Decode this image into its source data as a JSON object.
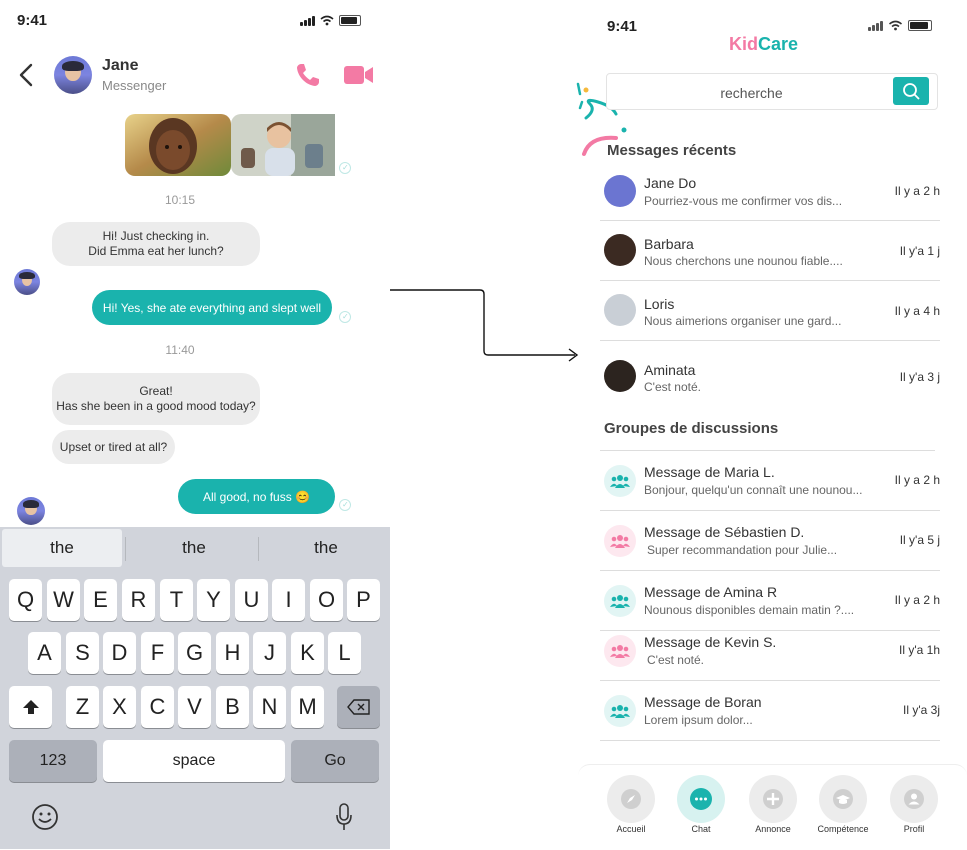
{
  "left": {
    "status_time": "9:41",
    "contact": {
      "name": "Jane",
      "subtitle": "Messenger"
    },
    "messages": {
      "time1": "10:15",
      "in1_line1": "Hi! Just checking in.",
      "in1_line2": "Did Emma eat her lunch?",
      "out1": "Hi! Yes, she ate everything and slept well",
      "time2": "11:40",
      "in2_line1": "Great!",
      "in2_line2": "Has she been in a good mood today?",
      "in3": "Upset or tired at all?",
      "out2": "All good, no fuss 😊"
    },
    "keyboard": {
      "suggestions": [
        "the",
        "the",
        "the"
      ],
      "row1": [
        "Q",
        "W",
        "E",
        "R",
        "T",
        "Y",
        "U",
        "I",
        "O",
        "P"
      ],
      "row2": [
        "A",
        "S",
        "D",
        "F",
        "G",
        "H",
        "J",
        "K",
        "L"
      ],
      "row3": [
        "Z",
        "X",
        "C",
        "V",
        "B",
        "N",
        "M"
      ],
      "numbers_label": "123",
      "space_label": "space",
      "go_label": "Go"
    }
  },
  "right": {
    "status_time": "9:41",
    "app": {
      "logo_part1": "Kid",
      "logo_part2": "Care"
    },
    "search": {
      "placeholder": "recherche"
    },
    "recent": {
      "title": "Messages récents",
      "items": [
        {
          "name": "Jane Do",
          "preview": "Pourriez-vous me confirmer vos dis...",
          "time": "Il y a 2 h"
        },
        {
          "name": "Barbara",
          "preview": "Nous cherchons une nounou fiable....",
          "time": "Il y'a 1 j"
        },
        {
          "name": "Loris",
          "preview": "Nous aimerions organiser une gard...",
          "time": "Il y a 4 h"
        },
        {
          "name": "Aminata",
          "preview": "C'est noté.",
          "time": "Il y'a 3 j"
        }
      ]
    },
    "groups": {
      "title": "Groupes de discussions",
      "items": [
        {
          "name": "Message de Maria L.",
          "preview": "Bonjour, quelqu'un connaît une nounou...",
          "time": "Il y a 2 h",
          "color": "#1ab3ad"
        },
        {
          "name": "Message de Sébastien D.",
          "preview": "Super recommandation pour Julie...",
          "time": "Il y'a 5 j",
          "color": "#f37aa4"
        },
        {
          "name": "Message de Amina R",
          "preview": "Nounous disponibles demain matin ?....",
          "time": "Il y a 2 h",
          "color": "#1ab3ad"
        },
        {
          "name": "Message de Kevin S.",
          "preview": "C'est noté.",
          "time": "Il y'a 1h",
          "color": "#f37aa4"
        },
        {
          "name": "Message de Boran",
          "preview": "Lorem ipsum dolor...",
          "time": "Il y'a 3j",
          "color": "#1ab3ad"
        }
      ]
    },
    "nav": [
      {
        "label": "Accueil",
        "icon": "compass-icon"
      },
      {
        "label": "Chat",
        "icon": "chat-icon"
      },
      {
        "label": "Annonce",
        "icon": "plus-icon"
      },
      {
        "label": "Compétence",
        "icon": "graduation-cap-icon"
      },
      {
        "label": "Profil",
        "icon": "user-icon"
      }
    ]
  },
  "colors": {
    "teal": "#1ab3ad",
    "pink": "#f37aa4"
  }
}
